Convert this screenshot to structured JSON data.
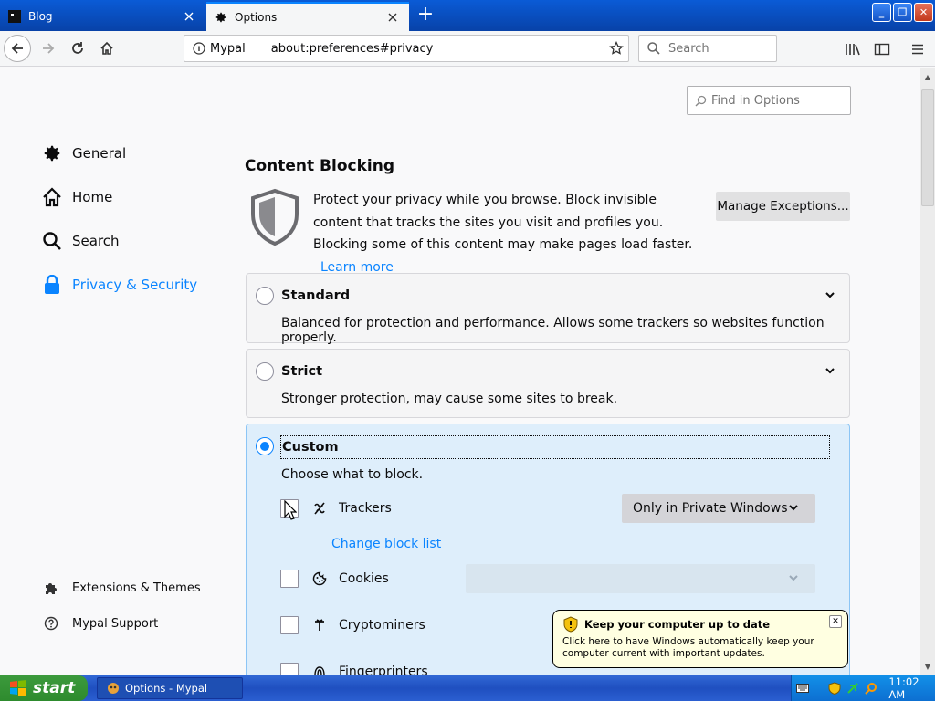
{
  "tabs": [
    {
      "label": "Blog",
      "active": false
    },
    {
      "label": "Options",
      "active": true
    }
  ],
  "navbar": {
    "identity_label": "Mypal",
    "url": "about:preferences#privacy",
    "search_placeholder": "Search"
  },
  "find": {
    "placeholder": "Find in Options"
  },
  "sidebar": {
    "categories": [
      {
        "label": "General",
        "icon": "gear-icon",
        "selected": false
      },
      {
        "label": "Home",
        "icon": "home-icon",
        "selected": false
      },
      {
        "label": "Search",
        "icon": "search-icon",
        "selected": false
      },
      {
        "label": "Privacy & Security",
        "icon": "lock-icon",
        "selected": true
      }
    ],
    "footer": [
      {
        "label": "Extensions & Themes",
        "icon": "puzzle-icon"
      },
      {
        "label": "Mypal Support",
        "icon": "help-icon"
      }
    ]
  },
  "content_blocking": {
    "heading": "Content Blocking",
    "intro": "Protect your privacy while you browse. Block invisible content that tracks the sites you visit and profiles you. Blocking some of this content may make pages load faster.",
    "learn_more": "Learn more",
    "manage_exceptions": "Manage Exceptions...",
    "options": [
      {
        "title": "Standard",
        "desc": "Balanced for protection and performance. Allows some trackers so websites function properly.",
        "selected": false
      },
      {
        "title": "Strict",
        "desc": "Stronger protection, may cause some sites to break.",
        "selected": false
      },
      {
        "title": "Custom",
        "desc": "Choose what to block.",
        "selected": true
      }
    ],
    "custom_items": [
      {
        "label": "Trackers",
        "checked": false,
        "icon": "tracker-icon"
      },
      {
        "label": "Cookies",
        "checked": false,
        "icon": "cookie-icon"
      },
      {
        "label": "Cryptominers",
        "checked": false,
        "icon": "cryptominer-icon"
      },
      {
        "label": "Fingerprinters",
        "checked": false,
        "icon": "fingerprint-icon"
      }
    ],
    "trackers_select": "Only in Private Windows",
    "cookies_select": "",
    "change_block_list": "Change block list"
  },
  "taskbar": {
    "start_label": "start",
    "task_label": "Options - Mypal",
    "clock": "11:02 AM"
  },
  "balloon": {
    "title": "Keep your computer up to date",
    "text": "Click here to have Windows automatically keep your computer current with important updates."
  },
  "colors": {
    "accent": "#0a84ff",
    "custom_card_bg": "#deeefb",
    "taskbar": "#245edb"
  }
}
